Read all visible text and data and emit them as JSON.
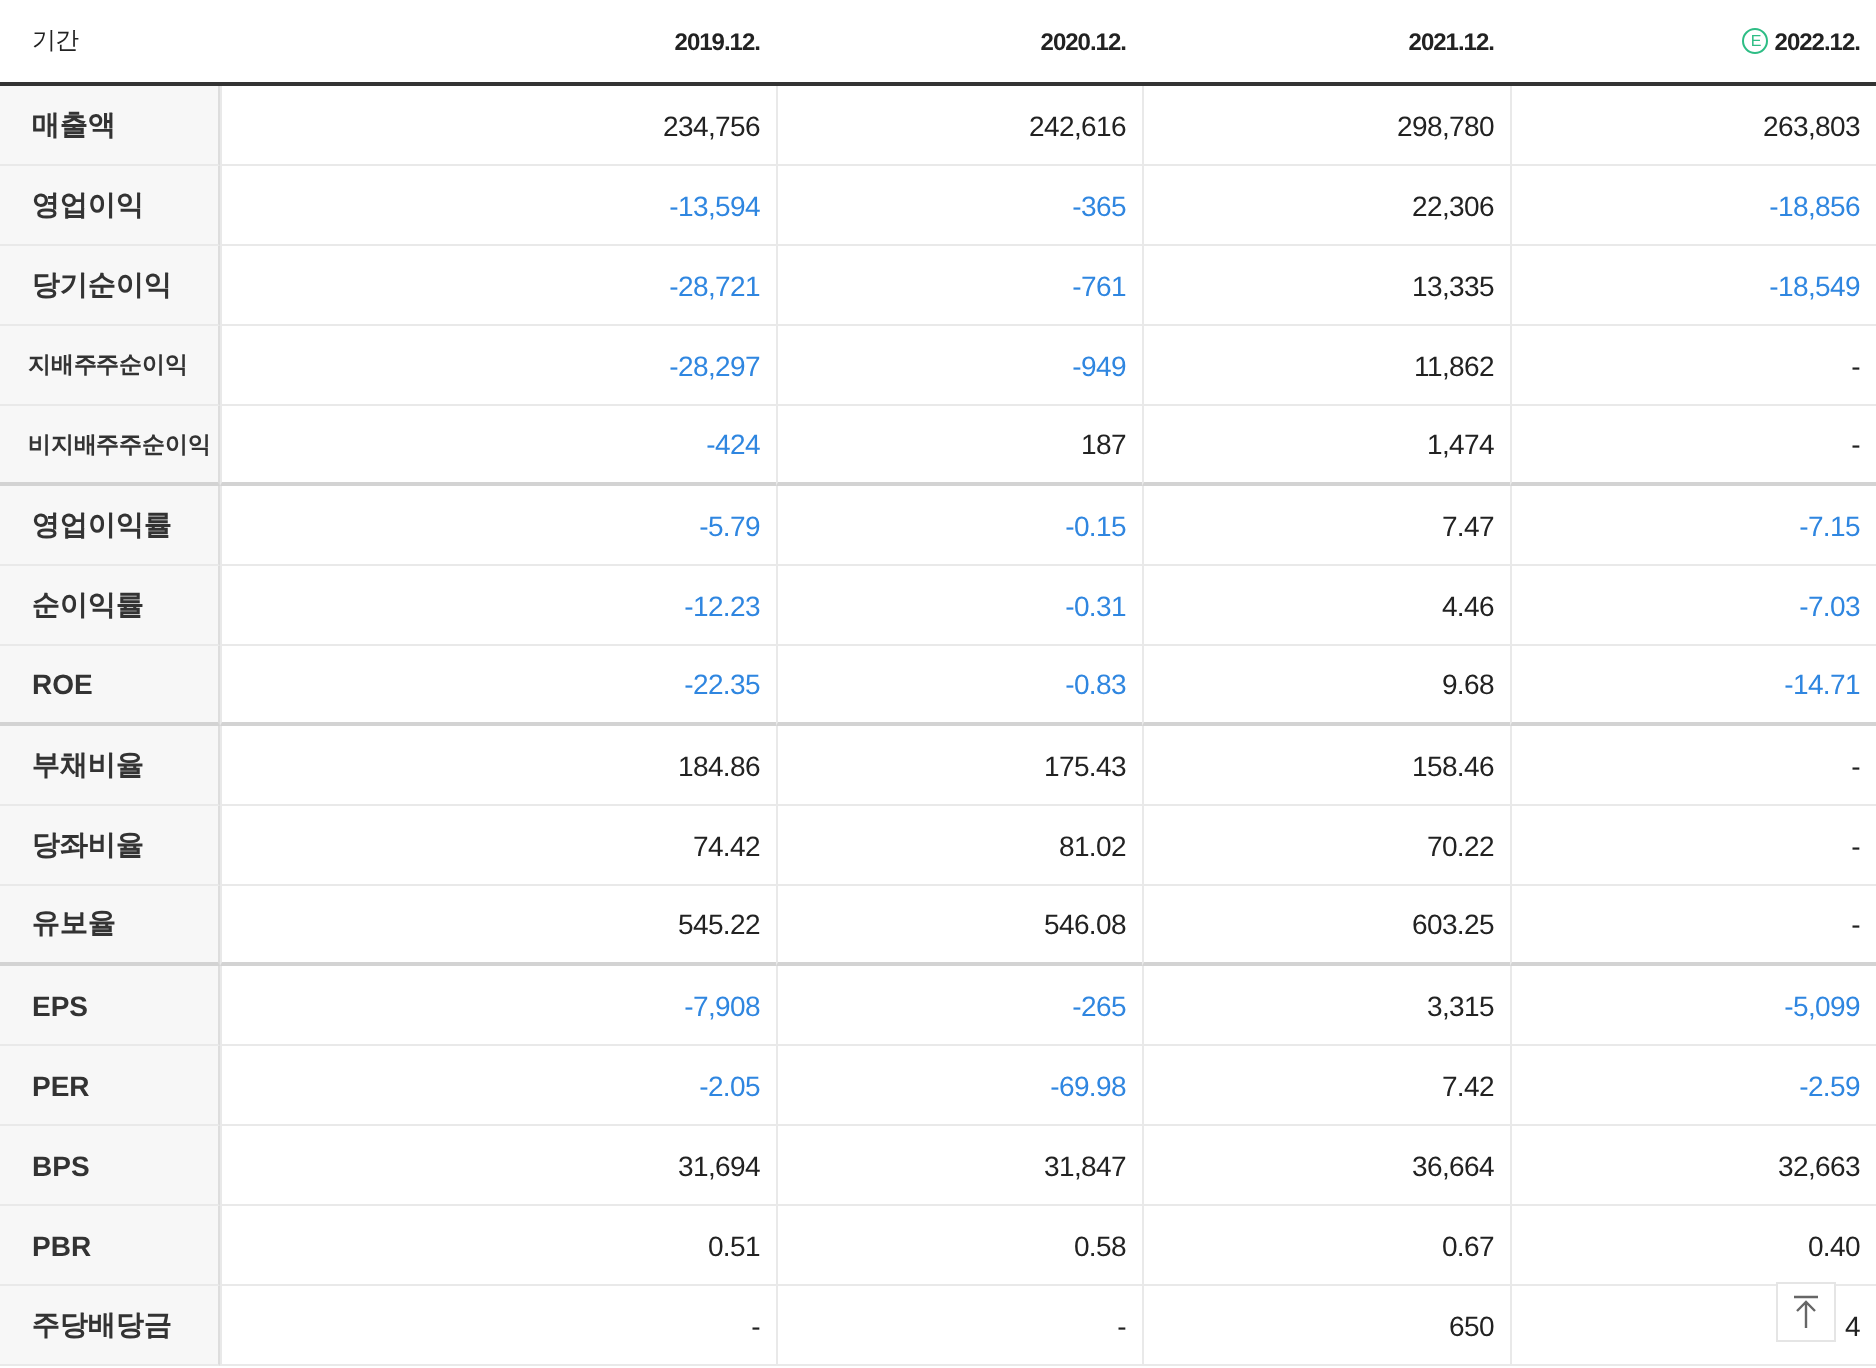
{
  "table": {
    "period_label": "기간",
    "columns": [
      {
        "label": "2019.12."
      },
      {
        "label": "2020.12."
      },
      {
        "label": "2021.12."
      },
      {
        "label": "2022.12.",
        "estimate_badge": "E"
      }
    ],
    "groups": [
      {
        "rows": [
          {
            "label": "매출액",
            "sub": false,
            "cells": [
              {
                "value": "234,756",
                "negative": false
              },
              {
                "value": "242,616",
                "negative": false
              },
              {
                "value": "298,780",
                "negative": false
              },
              {
                "value": "263,803",
                "negative": false
              }
            ]
          },
          {
            "label": "영업이익",
            "sub": false,
            "cells": [
              {
                "value": "-13,594",
                "negative": true
              },
              {
                "value": "-365",
                "negative": true
              },
              {
                "value": "22,306",
                "negative": false
              },
              {
                "value": "-18,856",
                "negative": true
              }
            ]
          },
          {
            "label": "당기순이익",
            "sub": false,
            "cells": [
              {
                "value": "-28,721",
                "negative": true
              },
              {
                "value": "-761",
                "negative": true
              },
              {
                "value": "13,335",
                "negative": false
              },
              {
                "value": "-18,549",
                "negative": true
              }
            ]
          },
          {
            "label": "지배주주순이익",
            "sub": true,
            "cells": [
              {
                "value": "-28,297",
                "negative": true
              },
              {
                "value": "-949",
                "negative": true
              },
              {
                "value": "11,862",
                "negative": false
              },
              {
                "value": "-",
                "negative": false
              }
            ]
          },
          {
            "label": "비지배주주순이익",
            "sub": true,
            "cells": [
              {
                "value": "-424",
                "negative": true
              },
              {
                "value": "187",
                "negative": false
              },
              {
                "value": "1,474",
                "negative": false
              },
              {
                "value": "-",
                "negative": false
              }
            ]
          }
        ]
      },
      {
        "rows": [
          {
            "label": "영업이익률",
            "sub": false,
            "cells": [
              {
                "value": "-5.79",
                "negative": true
              },
              {
                "value": "-0.15",
                "negative": true
              },
              {
                "value": "7.47",
                "negative": false
              },
              {
                "value": "-7.15",
                "negative": true
              }
            ]
          },
          {
            "label": "순이익률",
            "sub": false,
            "cells": [
              {
                "value": "-12.23",
                "negative": true
              },
              {
                "value": "-0.31",
                "negative": true
              },
              {
                "value": "4.46",
                "negative": false
              },
              {
                "value": "-7.03",
                "negative": true
              }
            ]
          },
          {
            "label": "ROE",
            "sub": false,
            "cells": [
              {
                "value": "-22.35",
                "negative": true
              },
              {
                "value": "-0.83",
                "negative": true
              },
              {
                "value": "9.68",
                "negative": false
              },
              {
                "value": "-14.71",
                "negative": true
              }
            ]
          }
        ]
      },
      {
        "rows": [
          {
            "label": "부채비율",
            "sub": false,
            "cells": [
              {
                "value": "184.86",
                "negative": false
              },
              {
                "value": "175.43",
                "negative": false
              },
              {
                "value": "158.46",
                "negative": false
              },
              {
                "value": "-",
                "negative": false
              }
            ]
          },
          {
            "label": "당좌비율",
            "sub": false,
            "cells": [
              {
                "value": "74.42",
                "negative": false
              },
              {
                "value": "81.02",
                "negative": false
              },
              {
                "value": "70.22",
                "negative": false
              },
              {
                "value": "-",
                "negative": false
              }
            ]
          },
          {
            "label": "유보율",
            "sub": false,
            "cells": [
              {
                "value": "545.22",
                "negative": false
              },
              {
                "value": "546.08",
                "negative": false
              },
              {
                "value": "603.25",
                "negative": false
              },
              {
                "value": "-",
                "negative": false
              }
            ]
          }
        ]
      },
      {
        "rows": [
          {
            "label": "EPS",
            "sub": false,
            "cells": [
              {
                "value": "-7,908",
                "negative": true
              },
              {
                "value": "-265",
                "negative": true
              },
              {
                "value": "3,315",
                "negative": false
              },
              {
                "value": "-5,099",
                "negative": true
              }
            ]
          },
          {
            "label": "PER",
            "sub": false,
            "cells": [
              {
                "value": "-2.05",
                "negative": true
              },
              {
                "value": "-69.98",
                "negative": true
              },
              {
                "value": "7.42",
                "negative": false
              },
              {
                "value": "-2.59",
                "negative": true
              }
            ]
          },
          {
            "label": "BPS",
            "sub": false,
            "cells": [
              {
                "value": "31,694",
                "negative": false
              },
              {
                "value": "31,847",
                "negative": false
              },
              {
                "value": "36,664",
                "negative": false
              },
              {
                "value": "32,663",
                "negative": false
              }
            ]
          },
          {
            "label": "PBR",
            "sub": false,
            "cells": [
              {
                "value": "0.51",
                "negative": false
              },
              {
                "value": "0.58",
                "negative": false
              },
              {
                "value": "0.67",
                "negative": false
              },
              {
                "value": "0.40",
                "negative": false
              }
            ]
          },
          {
            "label": "주당배당금",
            "sub": false,
            "cells": [
              {
                "value": "-",
                "negative": false
              },
              {
                "value": "-",
                "negative": false
              },
              {
                "value": "650",
                "negative": false
              },
              {
                "value": "4",
                "negative": false
              }
            ]
          }
        ]
      }
    ]
  }
}
